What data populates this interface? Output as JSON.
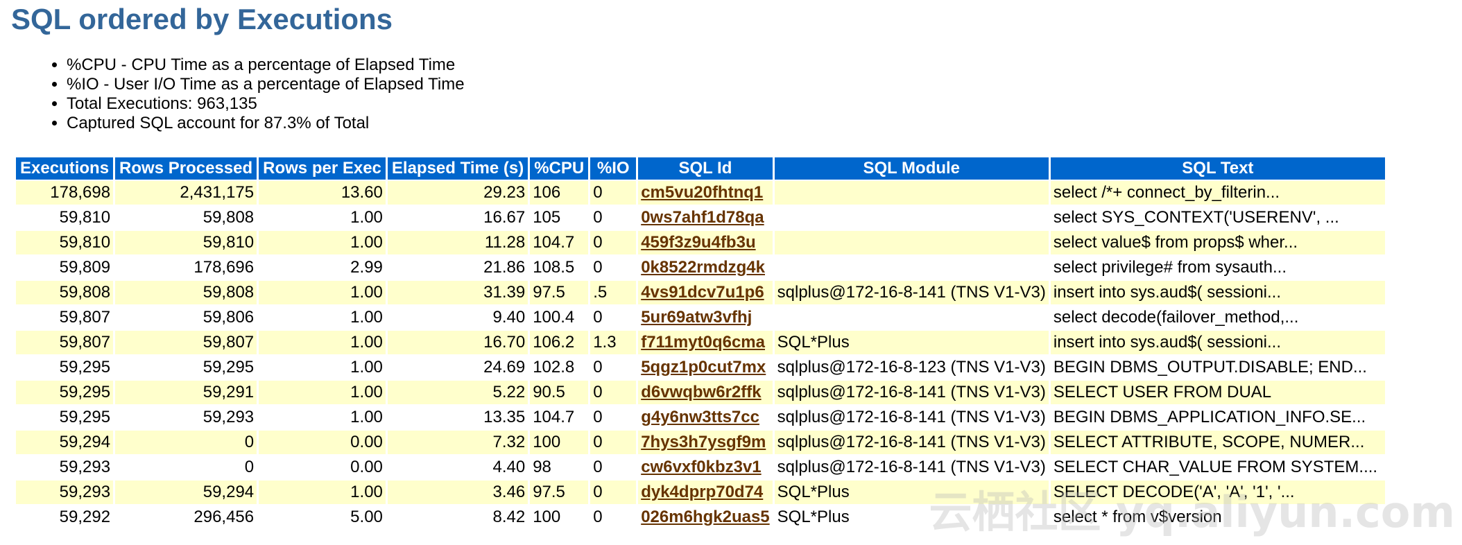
{
  "title": "SQL ordered by Executions",
  "notes": [
    "%CPU - CPU Time as a percentage of Elapsed Time",
    "%IO - User I/O Time as a percentage of Elapsed Time",
    "Total Executions: 963,135",
    "Captured SQL account for 87.3% of Total"
  ],
  "table": {
    "headers": [
      "Executions",
      "Rows Processed",
      "Rows per Exec",
      "Elapsed Time (s)",
      "%CPU",
      "%IO",
      "SQL Id",
      "SQL Module",
      "SQL Text"
    ],
    "rows": [
      [
        "178,698",
        "2,431,175",
        "13.60",
        "29.23",
        "106",
        "0",
        "cm5vu20fhtnq1",
        "",
        "select /*+ connect_by_filterin..."
      ],
      [
        "59,810",
        "59,808",
        "1.00",
        "16.67",
        "105",
        "0",
        "0ws7ahf1d78qa",
        "",
        "select SYS_CONTEXT('USERENV', ..."
      ],
      [
        "59,810",
        "59,810",
        "1.00",
        "11.28",
        "104.7",
        "0",
        "459f3z9u4fb3u",
        "",
        "select value$ from props$ wher..."
      ],
      [
        "59,809",
        "178,696",
        "2.99",
        "21.86",
        "108.5",
        "0",
        "0k8522rmdzg4k",
        "",
        "select privilege# from sysauth..."
      ],
      [
        "59,808",
        "59,808",
        "1.00",
        "31.39",
        "97.5",
        ".5",
        "4vs91dcv7u1p6",
        "sqlplus@172-16-8-141 (TNS V1-V3)",
        "insert into sys.aud$( sessioni..."
      ],
      [
        "59,807",
        "59,806",
        "1.00",
        "9.40",
        "100.4",
        "0",
        "5ur69atw3vfhj",
        "",
        "select decode(failover_method,..."
      ],
      [
        "59,807",
        "59,807",
        "1.00",
        "16.70",
        "106.2",
        "1.3",
        "f711myt0q6cma",
        "SQL*Plus",
        "insert into sys.aud$( sessioni..."
      ],
      [
        "59,295",
        "59,295",
        "1.00",
        "24.69",
        "102.8",
        "0",
        "5qgz1p0cut7mx",
        "sqlplus@172-16-8-123 (TNS V1-V3)",
        "BEGIN DBMS_OUTPUT.DISABLE; END..."
      ],
      [
        "59,295",
        "59,291",
        "1.00",
        "5.22",
        "90.5",
        "0",
        "d6vwqbw6r2ffk",
        "sqlplus@172-16-8-141 (TNS V1-V3)",
        "SELECT USER FROM DUAL"
      ],
      [
        "59,295",
        "59,293",
        "1.00",
        "13.35",
        "104.7",
        "0",
        "g4y6nw3tts7cc",
        "sqlplus@172-16-8-141 (TNS V1-V3)",
        "BEGIN DBMS_APPLICATION_INFO.SE..."
      ],
      [
        "59,294",
        "0",
        "0.00",
        "7.32",
        "100",
        "0",
        "7hys3h7ysgf9m",
        "sqlplus@172-16-8-141 (TNS V1-V3)",
        "SELECT ATTRIBUTE, SCOPE, NUMER..."
      ],
      [
        "59,293",
        "0",
        "0.00",
        "4.40",
        "98",
        "0",
        "cw6vxf0kbz3v1",
        "sqlplus@172-16-8-141 (TNS V1-V3)",
        "SELECT CHAR_VALUE FROM SYSTEM...."
      ],
      [
        "59,293",
        "59,294",
        "1.00",
        "3.46",
        "97.5",
        "0",
        "dyk4dprp70d74",
        "SQL*Plus",
        "SELECT DECODE('A', 'A', '1', '..."
      ],
      [
        "59,292",
        "296,456",
        "5.00",
        "8.42",
        "100",
        "0",
        "026m6hgk2uas5",
        "SQL*Plus",
        "select * from v$version"
      ]
    ]
  },
  "watermark": "云栖社区 yq.aliyun.com",
  "colors": {
    "title": "#336699",
    "header_bg": "#0066cc",
    "header_text": "#ffffff",
    "alt_row_bg": "#ffffcc",
    "link": "#663300"
  }
}
